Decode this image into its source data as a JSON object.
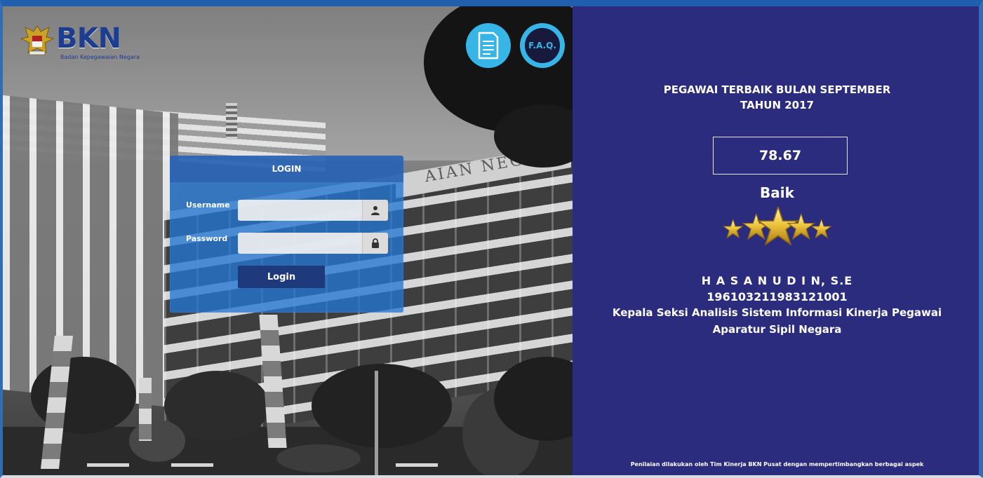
{
  "branding": {
    "logo_text": "BKN",
    "logo_subtext": "Badan Kepegawaian Negara"
  },
  "top_buttons": {
    "faq_label": "F.A.Q."
  },
  "login": {
    "title": "LOGIN",
    "username_label": "Username",
    "password_label": "Password",
    "button_label": "Login"
  },
  "employee_of_month": {
    "heading_line1": "PEGAWAI TERBAIK BULAN SEPTEMBER",
    "heading_line2": "TAHUN 2017",
    "score": "78.67",
    "grade": "Baik",
    "star_count": 5,
    "name": "H A S A N U D I N, S.E",
    "nip": "196103211983121001",
    "position_line1": "Kepala Seksi Analisis Sistem Informasi Kinerja Pegawai",
    "position_line2": "Aparatur Sipil Negara",
    "footnote": "Penilaian dilakukan oleh Tim Kinerja BKN Pusat dengan mempertimbangkan berbagai aspek"
  },
  "background": {
    "sign_text": "BADAN KEPEGAWAIAN NEGARA"
  },
  "colors": {
    "right_panel": "#2b2c7d",
    "login_panel": "#2476d2",
    "login_button": "#1f3a7c",
    "accent": "#37b5e6",
    "star": "#e9c13a"
  }
}
